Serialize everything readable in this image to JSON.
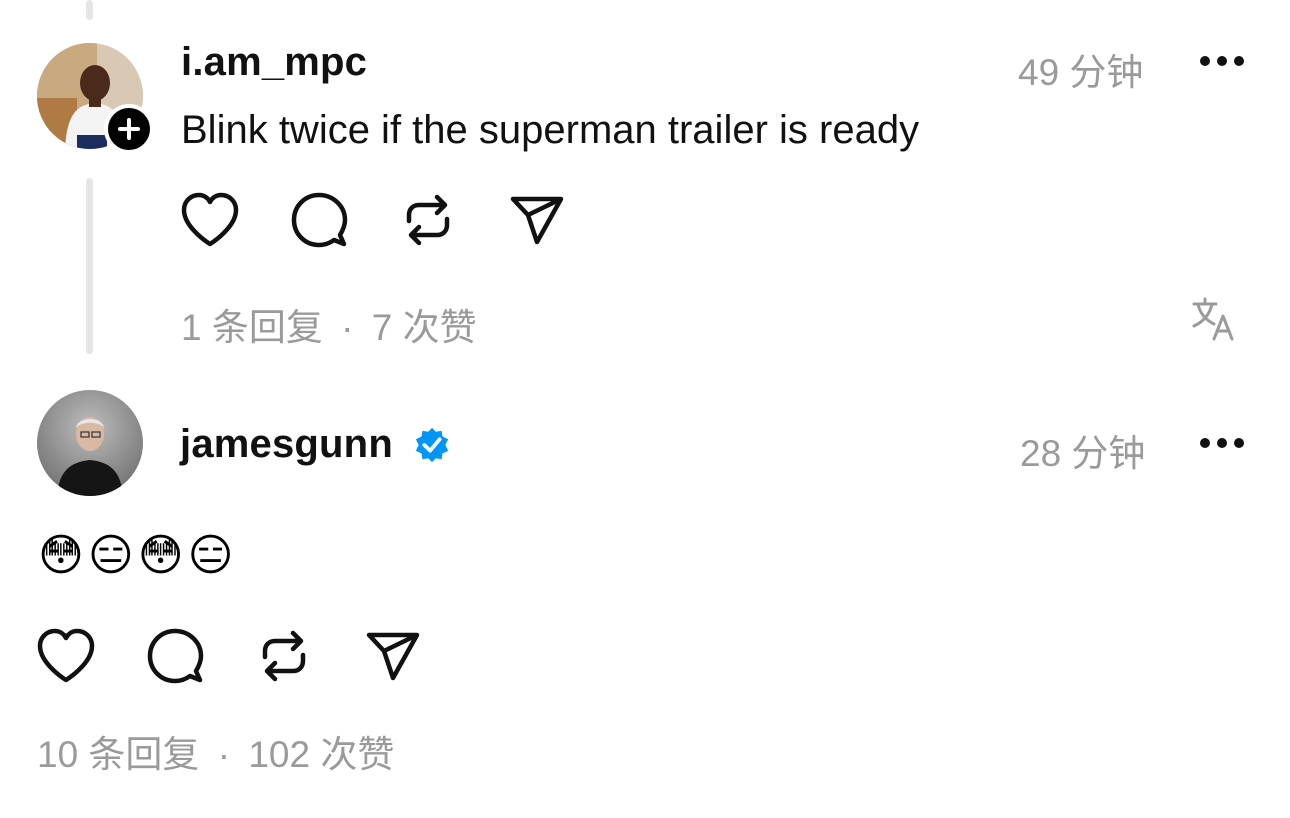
{
  "posts": [
    {
      "username": "i.am_mpc",
      "timestamp": "49 分钟",
      "text": "Blink twice if the superman trailer is ready",
      "replies": "1 条回复",
      "separator": "·",
      "likes": "7 次赞",
      "verified": false
    },
    {
      "username": "jamesgunn",
      "timestamp": "28 分钟",
      "text": "😳😑😳😑",
      "replies": "10 条回复",
      "separator": "·",
      "likes": "102 次赞",
      "verified": true
    }
  ],
  "icons": {
    "like": "heart-icon",
    "reply": "comment-icon",
    "repost": "repost-icon",
    "share": "send-icon",
    "more": "more-icon",
    "translate": "translate-icon",
    "follow": "plus-icon",
    "verified": "verified-badge-icon"
  },
  "colors": {
    "text": "#111111",
    "muted": "#9a9a9a",
    "verified": "#0095f6",
    "thread_line": "#e6e6e6"
  }
}
